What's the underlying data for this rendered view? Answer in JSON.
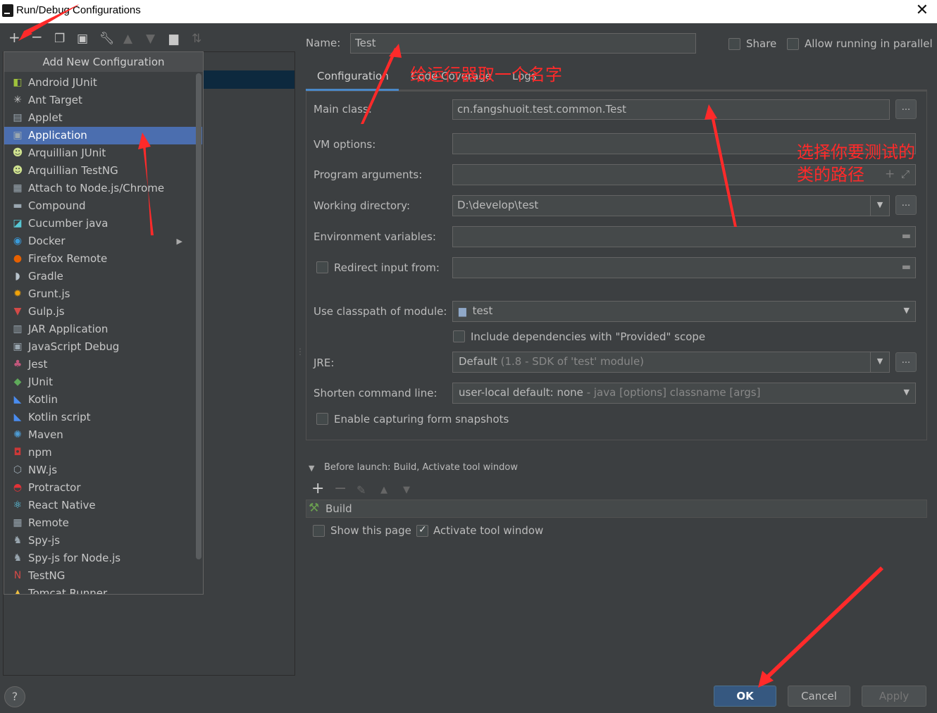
{
  "window": {
    "title": "Run/Debug Configurations",
    "close_glyph": "✕"
  },
  "toolbar": {
    "icons": [
      "add-icon",
      "remove-icon",
      "copy-icon",
      "save-icon",
      "wrench-icon",
      "move-up-icon",
      "move-down-icon",
      "folder-add-icon",
      "sort-icon"
    ]
  },
  "popup": {
    "header": "Add New Configuration",
    "items": [
      {
        "label": "Android JUnit",
        "icon": "android-junit-icon",
        "glyph": "◧",
        "color": "#9fc23c"
      },
      {
        "label": "Ant Target",
        "icon": "ant-icon",
        "glyph": "✳",
        "color": "#c8c8c8"
      },
      {
        "label": "Applet",
        "icon": "applet-icon",
        "glyph": "▤",
        "color": "#9aa7b0"
      },
      {
        "label": "Application",
        "icon": "application-icon",
        "glyph": "▣",
        "color": "#9aa7b0"
      },
      {
        "label": "Arquillian JUnit",
        "icon": "arquillian-junit-icon",
        "glyph": "☻",
        "color": "#cfe28f"
      },
      {
        "label": "Arquillian TestNG",
        "icon": "arquillian-testng-icon",
        "glyph": "☻",
        "color": "#cfe28f"
      },
      {
        "label": "Attach to Node.js/Chrome",
        "icon": "attach-node-icon",
        "glyph": "▦",
        "color": "#9aa7b0"
      },
      {
        "label": "Compound",
        "icon": "compound-icon",
        "glyph": "▬",
        "color": "#9aa7b0"
      },
      {
        "label": "Cucumber java",
        "icon": "cucumber-icon",
        "glyph": "◪",
        "color": "#57c7d4"
      },
      {
        "label": "Docker",
        "icon": "docker-icon",
        "glyph": "◉",
        "color": "#3a9ad9",
        "submenu": true
      },
      {
        "label": "Firefox Remote",
        "icon": "firefox-icon",
        "glyph": "●",
        "color": "#e66000"
      },
      {
        "label": "Gradle",
        "icon": "gradle-icon",
        "glyph": "◗",
        "color": "#b8c3cc"
      },
      {
        "label": "Grunt.js",
        "icon": "grunt-icon",
        "glyph": "✹",
        "color": "#f0a30a"
      },
      {
        "label": "Gulp.js",
        "icon": "gulp-icon",
        "glyph": "▼",
        "color": "#d34a47"
      },
      {
        "label": "JAR Application",
        "icon": "jar-icon",
        "glyph": "▥",
        "color": "#9aa7b0"
      },
      {
        "label": "JavaScript Debug",
        "icon": "js-debug-icon",
        "glyph": "▣",
        "color": "#9aa7b0"
      },
      {
        "label": "Jest",
        "icon": "jest-icon",
        "glyph": "♣",
        "color": "#c2577c"
      },
      {
        "label": "JUnit",
        "icon": "junit-icon",
        "glyph": "◆",
        "color": "#5faa5a"
      },
      {
        "label": "Kotlin",
        "icon": "kotlin-icon",
        "glyph": "◣",
        "color": "#4a8cf0"
      },
      {
        "label": "Kotlin script",
        "icon": "kotlin-script-icon",
        "glyph": "◣",
        "color": "#4a8cf0"
      },
      {
        "label": "Maven",
        "icon": "maven-icon",
        "glyph": "✺",
        "color": "#4e9cd4"
      },
      {
        "label": "npm",
        "icon": "npm-icon",
        "glyph": "◘",
        "color": "#cb3837"
      },
      {
        "label": "NW.js",
        "icon": "nwjs-icon",
        "glyph": "⬡",
        "color": "#9aa7b0"
      },
      {
        "label": "Protractor",
        "icon": "protractor-icon",
        "glyph": "◓",
        "color": "#e23237"
      },
      {
        "label": "React Native",
        "icon": "react-icon",
        "glyph": "⚛",
        "color": "#61dafb"
      },
      {
        "label": "Remote",
        "icon": "remote-icon",
        "glyph": "▦",
        "color": "#9aa7b0"
      },
      {
        "label": "Spy-js",
        "icon": "spyjs-icon",
        "glyph": "♞",
        "color": "#9aa7b0"
      },
      {
        "label": "Spy-js for Node.js",
        "icon": "spyjs-node-icon",
        "glyph": "♞",
        "color": "#9aa7b0"
      },
      {
        "label": "TestNG",
        "icon": "testng-icon",
        "glyph": "N",
        "color": "#d34a47"
      },
      {
        "label": "Tomcat Runner",
        "icon": "tomcat-icon",
        "glyph": "▲",
        "color": "#f0c040"
      }
    ],
    "selected_index": 3
  },
  "form": {
    "name_label": "Name:",
    "name_value": "Test",
    "share_label": "Share",
    "parallel_label": "Allow running in parallel",
    "tabs": [
      "Configuration",
      "Code Coverage",
      "Logs"
    ],
    "main_class_label": "Main class:",
    "main_class_value": "cn.fangshuoit.test.common.Test",
    "vm_options_label": "VM options:",
    "program_args_label": "Program arguments:",
    "working_dir_label": "Working directory:",
    "working_dir_value": "D:\\develop\\test",
    "env_vars_label": "Environment variables:",
    "redirect_label": "Redirect input from:",
    "classpath_label": "Use classpath of module:",
    "classpath_value": "test",
    "include_deps_label": "Include dependencies with \"Provided\" scope",
    "jre_label": "JRE:",
    "jre_value": "Default",
    "jre_detail": "(1.8 - SDK of 'test' module)",
    "shorten_label": "Shorten command line:",
    "shorten_value": "user-local default: none",
    "shorten_detail": "- java [options] classname [args]",
    "snapshots_label": "Enable capturing form snapshots",
    "ellipsis": "..."
  },
  "before_launch": {
    "title": "Before launch: Build, Activate tool window",
    "task": "Build",
    "show_page_label": "Show this page",
    "activate_label": "Activate tool window"
  },
  "buttons": {
    "ok": "OK",
    "cancel": "Cancel",
    "apply": "Apply",
    "help": "?"
  },
  "annotations": {
    "name_hint": "给运行器取一个名字",
    "class_hint_line1": "选择你要测试的",
    "class_hint_line2": "类的路径",
    "color": "#ff2a2a"
  }
}
